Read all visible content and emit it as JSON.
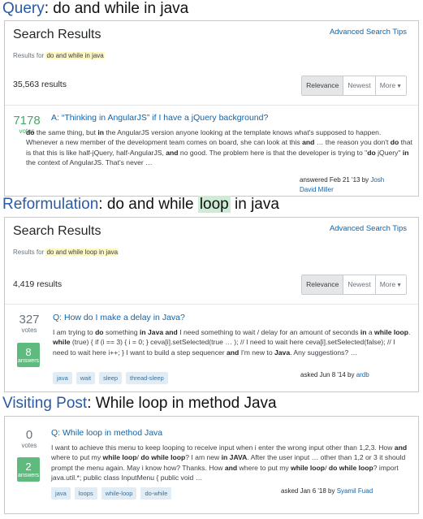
{
  "query_section": {
    "heading_label": "Query",
    "heading_text": ": do and while in java",
    "search_title": "Search Results",
    "advanced_link": "Advanced Search Tips",
    "results_for_prefix": "Results for ",
    "query": "do and while in java",
    "count": "35,563 results",
    "tabs": [
      "Relevance",
      "Newest",
      "More"
    ],
    "active_tab": "Relevance",
    "result": {
      "votes": "7178",
      "votes_label": "votes",
      "title": "A: “Thinking in AngularJS” if I have a jQuery background?",
      "excerpt_html": "<b>do</b> the same thing, but <b>in</b> the AngularJS version anyone looking at the template knows what's supposed to happen. Whenever a new member of the development team comes on board, she can look at this <b>and</b> … the reason you don't <b>do</b> that is that this is like half-jQuery, half-AngularJS, <b>and</b> no good. The problem here is that the developer is trying to \"<b>do</b> jQuery\" <b>in</b> the context of AngularJS. That's never …",
      "meta_prefix": "answered Feb 21 '13 by ",
      "user_line1": "Josh",
      "user_line2": "David Miller"
    }
  },
  "reformulation_section": {
    "heading_label": "Reformulation",
    "heading_pre": ": do and while ",
    "heading_highlight": "loop",
    "heading_post": " in java",
    "search_title": "Search Results",
    "advanced_link": "Advanced Search Tips",
    "results_for_prefix": "Results for ",
    "query": "do and while loop in java",
    "count": "4,419 results",
    "tabs": [
      "Relevance",
      "Newest",
      "More"
    ],
    "active_tab": "Relevance",
    "result": {
      "votes": "327",
      "votes_label": "votes",
      "answers": "8",
      "answers_label": "answers",
      "title": "Q: How do I make a delay in Java?",
      "excerpt_html": "I am trying to <b>do</b> something <b>in Java and</b> I need something to wait / delay for an amount of seconds <b>in</b> a <b>while loop</b>. <b>while</b> (true) { if (i == 3) { i = 0; } ceva[i].setSelected(true … ); // I need to wait here ceva[i].setSelected(false); // I need to wait here i++; } I want to build a step sequencer <b>and</b> I'm new to <b>Java</b>. Any suggestions? …",
      "tags": [
        "java",
        "wait",
        "sleep",
        "thread-sleep"
      ],
      "meta_prefix": "asked Jun 8 '14 by ",
      "user": "ardb"
    }
  },
  "visiting_section": {
    "heading_label": "Visiting Post",
    "heading_text": ": While loop in method Java",
    "result": {
      "votes": "0",
      "votes_label": "votes",
      "answers": "2",
      "answers_label": "answers",
      "title": "Q: While loop in method Java",
      "excerpt_html": "I want to achieve this menu to keep looping to receive input when i enter the wrong input other than 1,2,3. How <b>and</b> where to put my <b>while loop</b>/ <b>do while loop</b>? I am new <b>in JAVA</b>. After the user input … other than 1,2 or 3 it should prompt the menu again. May i know how? Thanks. How <b>and</b> where to put my <b>while loop</b>/ <b>do while loop</b>? import java.util.*; public class InputMenu { public void …",
      "tags": [
        "java",
        "loops",
        "while-loop",
        "do-while"
      ],
      "meta_prefix": "asked Jan 6 '18 by ",
      "user": "Syamil Fuad"
    }
  },
  "colors": {
    "label_blue": "#2a5aa5",
    "link_blue": "#0c65b0",
    "accepted_green": "#5eba7d",
    "query_highlight": "#fdf7c3",
    "reformulation_highlight": "#cdebd5"
  },
  "icons": {
    "more_caret": "caret-down-icon"
  }
}
